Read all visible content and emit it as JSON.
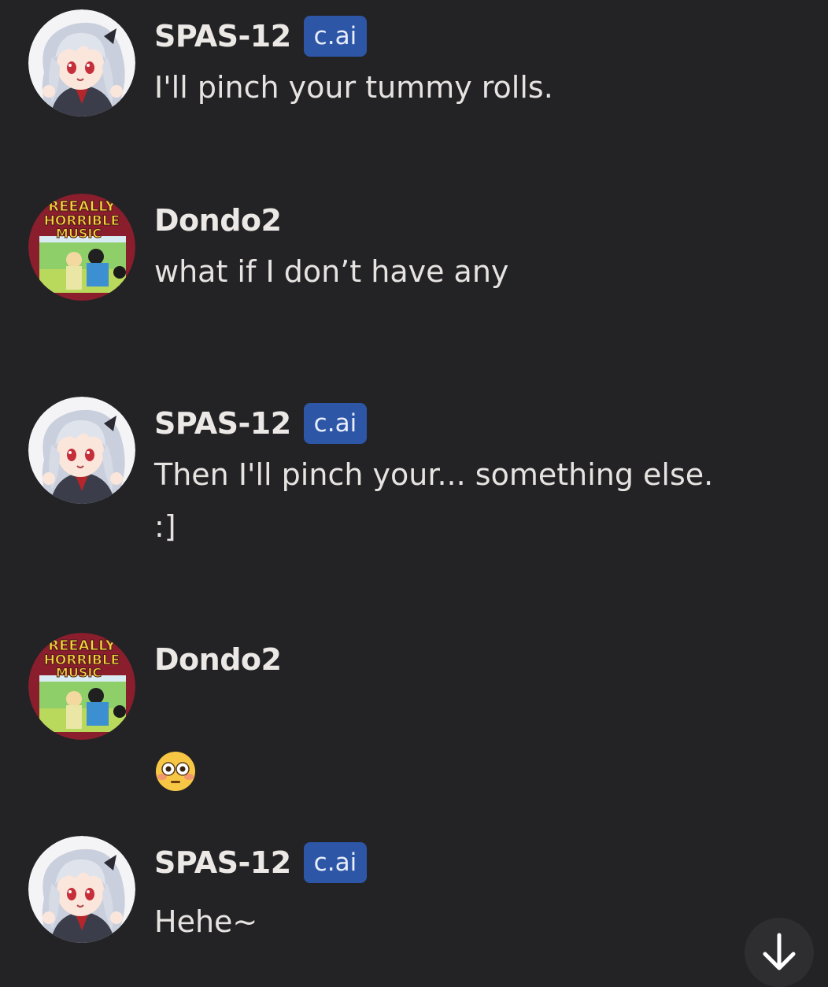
{
  "messages": [
    {
      "sender": "SPAS-12",
      "badge": "c.ai",
      "text": "I'll pinch your tummy rolls.",
      "avatar": "spas12-anime-avatar"
    },
    {
      "sender": "Dondo2",
      "badge": "",
      "text": "what if I don’t have any",
      "avatar": "reeally-horrible-music-avatar"
    },
    {
      "sender": "SPAS-12",
      "badge": "c.ai",
      "text": "Then I'll pinch your... something else.\n:]",
      "avatar": "spas12-anime-avatar"
    },
    {
      "sender": "Dondo2",
      "badge": "",
      "text": "😳",
      "avatar": "reeally-horrible-music-avatar"
    },
    {
      "sender": "SPAS-12",
      "badge": "c.ai",
      "text": "Hehe~",
      "avatar": "spas12-anime-avatar"
    }
  ],
  "avatar_text": {
    "line1": "REEALLY",
    "line2": "HORRIBLE",
    "line3": "MUSIC"
  },
  "scroll_button": {
    "icon": "arrow-down-icon"
  },
  "colors": {
    "background": "#232325",
    "badge": "#2d56a7",
    "text": "#e6e3e1"
  }
}
